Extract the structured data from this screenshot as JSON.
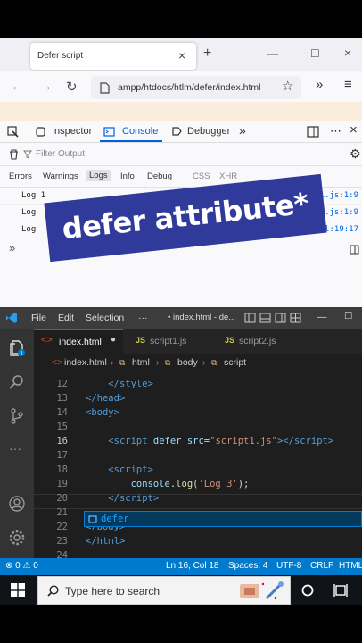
{
  "browser": {
    "tab_title": "Defer script",
    "url": "ampp/htdocs/htlm/defer/index.html",
    "devtools": {
      "tabs": [
        "Inspector",
        "Console",
        "Debugger"
      ],
      "filter_placeholder": "Filter Output",
      "levels": [
        "Errors",
        "Warnings",
        "Logs",
        "Info",
        "Debug",
        "CSS",
        "XHR"
      ],
      "logs": [
        {
          "msg": "Log 1",
          "src": "script1.js:1:9"
        },
        {
          "msg": "Log",
          "src": "script2.js:1:9"
        },
        {
          "msg": "Log",
          "src": "index.html:19:17"
        }
      ]
    }
  },
  "overlay": {
    "banner": "defer attribute*"
  },
  "vscode": {
    "menu": [
      "File",
      "Edit",
      "Selection",
      "···"
    ],
    "title": "• index.html - de...",
    "tabs": [
      {
        "label": "index.html",
        "dirty": true,
        "active": true
      },
      {
        "label": "script1.js",
        "active": false
      },
      {
        "label": "script2.js",
        "active": false
      }
    ],
    "breadcrumbs": [
      "index.html",
      "html",
      "body",
      "script"
    ],
    "line_numbers": [
      "12",
      "13",
      "14",
      "15",
      "16",
      "17",
      "18",
      "19",
      "20",
      "21",
      "22",
      "23",
      "24"
    ],
    "suggestion": "defer",
    "status": {
      "problems": "⊗ 0 ⚠ 0",
      "position": "Ln 16, Col 18",
      "spaces": "Spaces: 4",
      "encoding": "UTF-8",
      "eol": "CRLF",
      "language": "HTML"
    },
    "colors": {
      "status": "#007acc",
      "tag": "#569cd6",
      "string": "#ce9178",
      "attr": "#9cdcfe"
    }
  },
  "taskbar": {
    "search_placeholder": "Type here to search"
  }
}
